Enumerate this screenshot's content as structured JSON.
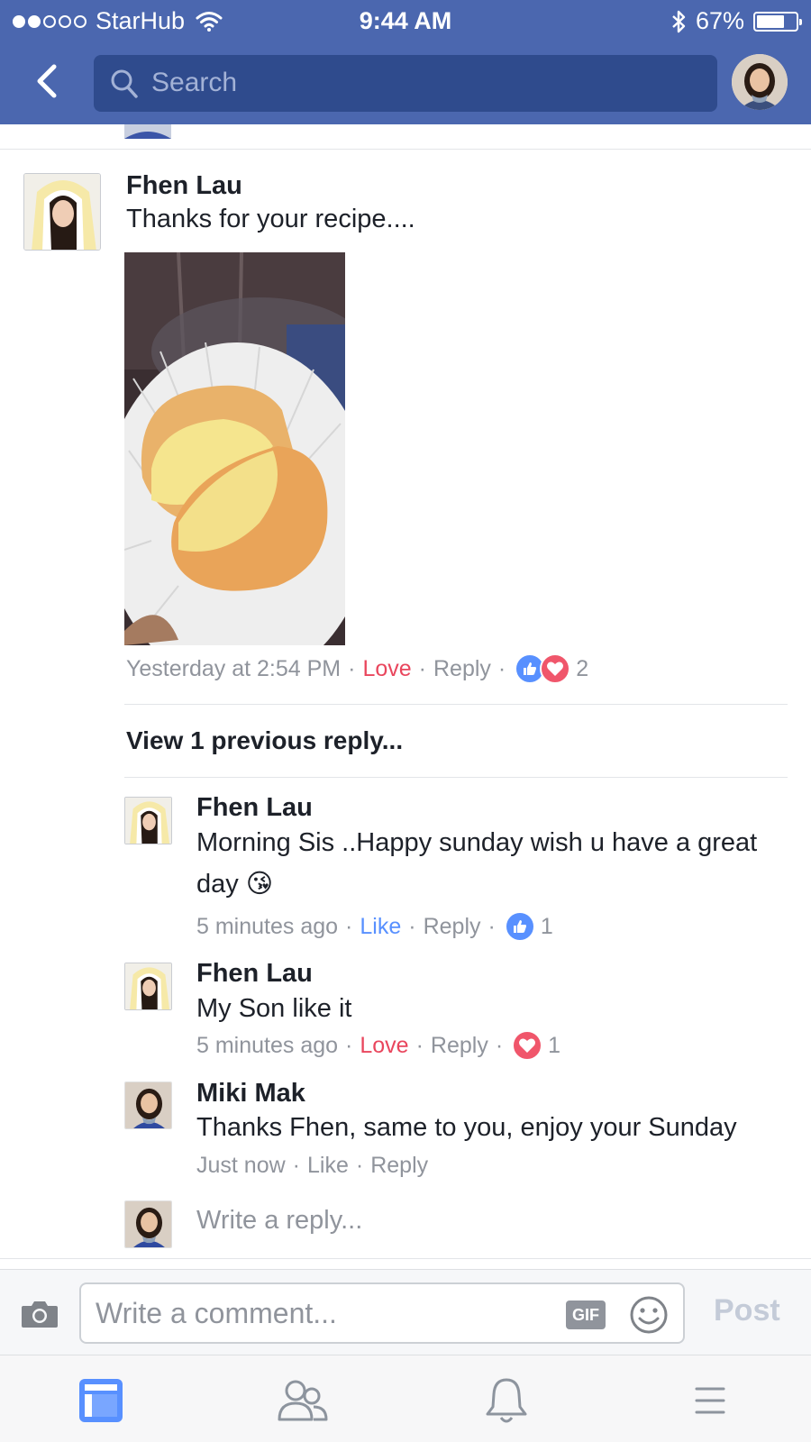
{
  "status_bar": {
    "carrier": "StarHub",
    "time": "9:44 AM",
    "battery": "67%",
    "battery_level": 0.67,
    "signal_bars_filled": 2,
    "signal_bars_total": 5
  },
  "nav": {
    "search_placeholder": "Search",
    "back_icon": "chevron-left-icon",
    "profile_avatar": "user-avatar"
  },
  "thread": {
    "comment": {
      "author": "Fhen Lau",
      "text": "Thanks for your recipe....",
      "timestamp": "Yesterday at 2:54 PM",
      "action_reaction": "Love",
      "action_reply": "Reply",
      "reaction_count": "2",
      "reactions": [
        "like",
        "love"
      ]
    },
    "view_previous": "View 1 previous reply...",
    "replies": [
      {
        "author": "Fhen Lau",
        "text": "Morning Sis ..Happy sunday wish u have a great day 😘",
        "timestamp": "5 minutes ago",
        "action_reaction": "Like",
        "action_reply": "Reply",
        "reaction_count": "1",
        "reaction": "like"
      },
      {
        "author": "Fhen Lau",
        "text": "My Son like it",
        "timestamp": "5 minutes ago",
        "action_reaction": "Love",
        "action_reply": "Reply",
        "reaction_count": "1",
        "reaction": "love"
      },
      {
        "author": "Miki Mak",
        "text": "Thanks Fhen, same to you, enjoy your Sunday",
        "timestamp": "Just now",
        "action_reaction": "Like",
        "action_reply": "Reply"
      }
    ],
    "write_reply_placeholder": "Write a reply..."
  },
  "composer": {
    "placeholder": "Write a comment...",
    "gif_label": "GIF",
    "post_label": "Post"
  },
  "tab_bar": {
    "tabs": [
      "news-feed-icon",
      "friends-icon",
      "notifications-icon",
      "menu-icon"
    ],
    "active_tab": "news-feed-icon"
  },
  "colors": {
    "brand": "#4b67af",
    "love": "#e9465d",
    "like": "#5890ff",
    "muted": "#90949c"
  }
}
